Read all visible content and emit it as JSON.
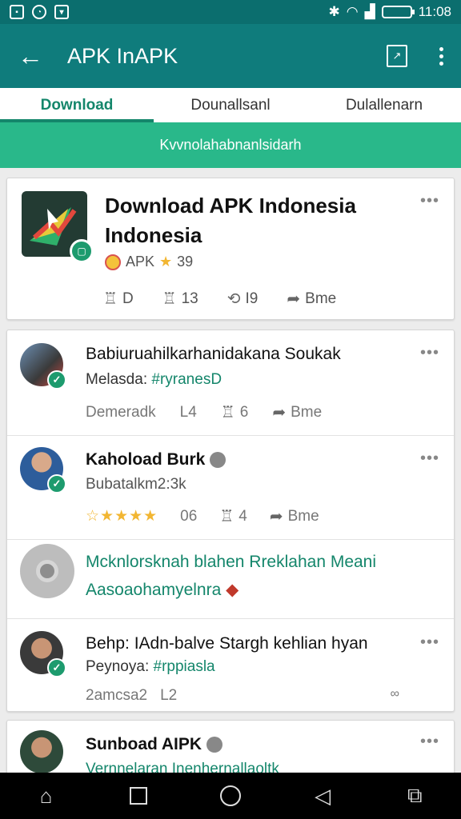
{
  "status_bar": {
    "time": "11:08"
  },
  "app_bar": {
    "back_icon": "arrow-left-icon",
    "title": "APK InAPK",
    "share_icon": "share-box-icon",
    "menu_icon": "more-vert-icon"
  },
  "tabs": [
    {
      "label": "Download",
      "active": true
    },
    {
      "label": "Dounallsanl",
      "active": false
    },
    {
      "label": "Dulallenarn",
      "active": false
    }
  ],
  "banner": {
    "text": "Kvvnolahabnanlsidarh"
  },
  "featured": {
    "title": "Download APK Indonesia Indonesia",
    "rating_label": "APK",
    "rating": "39",
    "actions": {
      "download": "D",
      "likes": "13",
      "reposts": "I9",
      "share": "Bme"
    }
  },
  "posts": [
    {
      "title": "Babiuruahilkarhanidakana Soukak",
      "subtitle_prefix": "Melasda:",
      "tag": "#ryranesD",
      "actions": {
        "meta": "Demeradk",
        "count": "L4",
        "likes": "6",
        "share": "Bme"
      }
    },
    {
      "title": "Kahoload Burk",
      "subtitle": "Bubatalkm2:3k",
      "actions": {
        "count": "06",
        "likes": "4",
        "share": "Bme"
      }
    },
    {
      "promo_line1": "Mcknlorsknah blahen Rreklahan Meani",
      "promo_line2": "Aasoaohamyelnra"
    },
    {
      "title": "Behp: IAdn-balve Stargh kehlian hyan",
      "subtitle_prefix": "Peynoya:",
      "tag": "#rppiasla",
      "actions": {
        "meta": "2amcsa2",
        "count": "L2"
      }
    },
    {
      "title": "Sunboad AIPK",
      "subtitle": "Vernnelaran Inenhernallaoltk"
    }
  ],
  "colors": {
    "primary": "#0f7c7c",
    "accent": "#29b88a",
    "tab_active": "#14866b"
  },
  "nav": {
    "home": "home-icon",
    "recent": "square-icon",
    "circle": "circle-icon",
    "back": "triangle-back-icon",
    "screenshot": "screenshot-icon"
  }
}
